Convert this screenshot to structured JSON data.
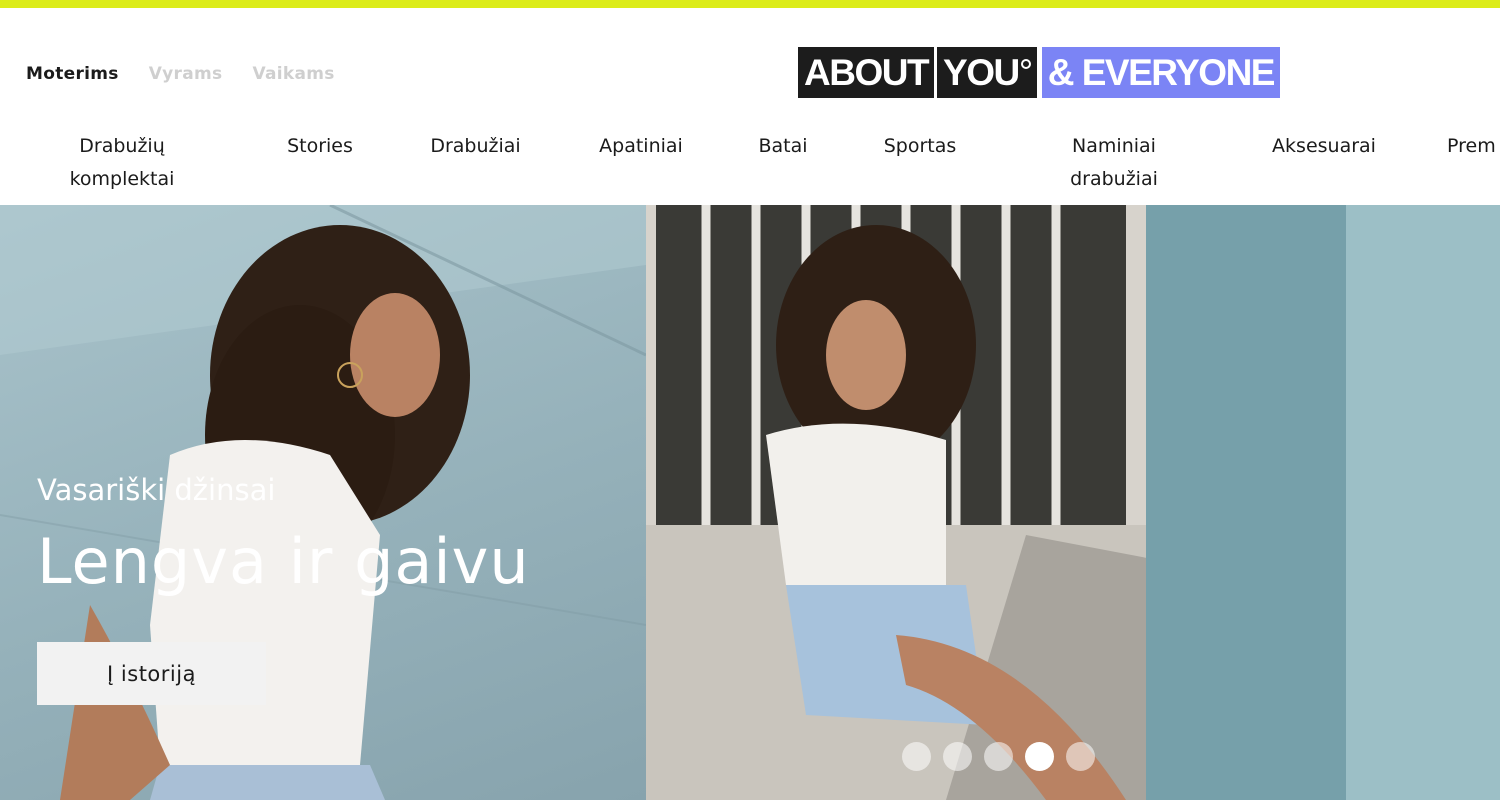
{
  "header": {
    "accent_color": "#dcec1a",
    "gender_tabs": [
      {
        "label": "Moterims",
        "active": true
      },
      {
        "label": "Vyrams",
        "active": false
      },
      {
        "label": "Vaikams",
        "active": false
      }
    ],
    "logo": {
      "part1": "ABOUT",
      "part2": "YOU",
      "part3": "& EVERYONE",
      "brand_color": "#7b84f5"
    }
  },
  "categories": [
    {
      "label": "Drabužių komplektai"
    },
    {
      "label": "Stories"
    },
    {
      "label": "Drabužiai"
    },
    {
      "label": "Apatiniai"
    },
    {
      "label": "Batai"
    },
    {
      "label": "Sportas"
    },
    {
      "label": "Naminiai drabužiai"
    },
    {
      "label": "Aksesuarai"
    },
    {
      "label": "Prem"
    }
  ],
  "hero": {
    "subtitle": "Vasariški džinsai",
    "title": "Lengva ir gaivu",
    "button_label": "Į istoriją",
    "slides": {
      "count": 5,
      "active_index": 3
    }
  }
}
